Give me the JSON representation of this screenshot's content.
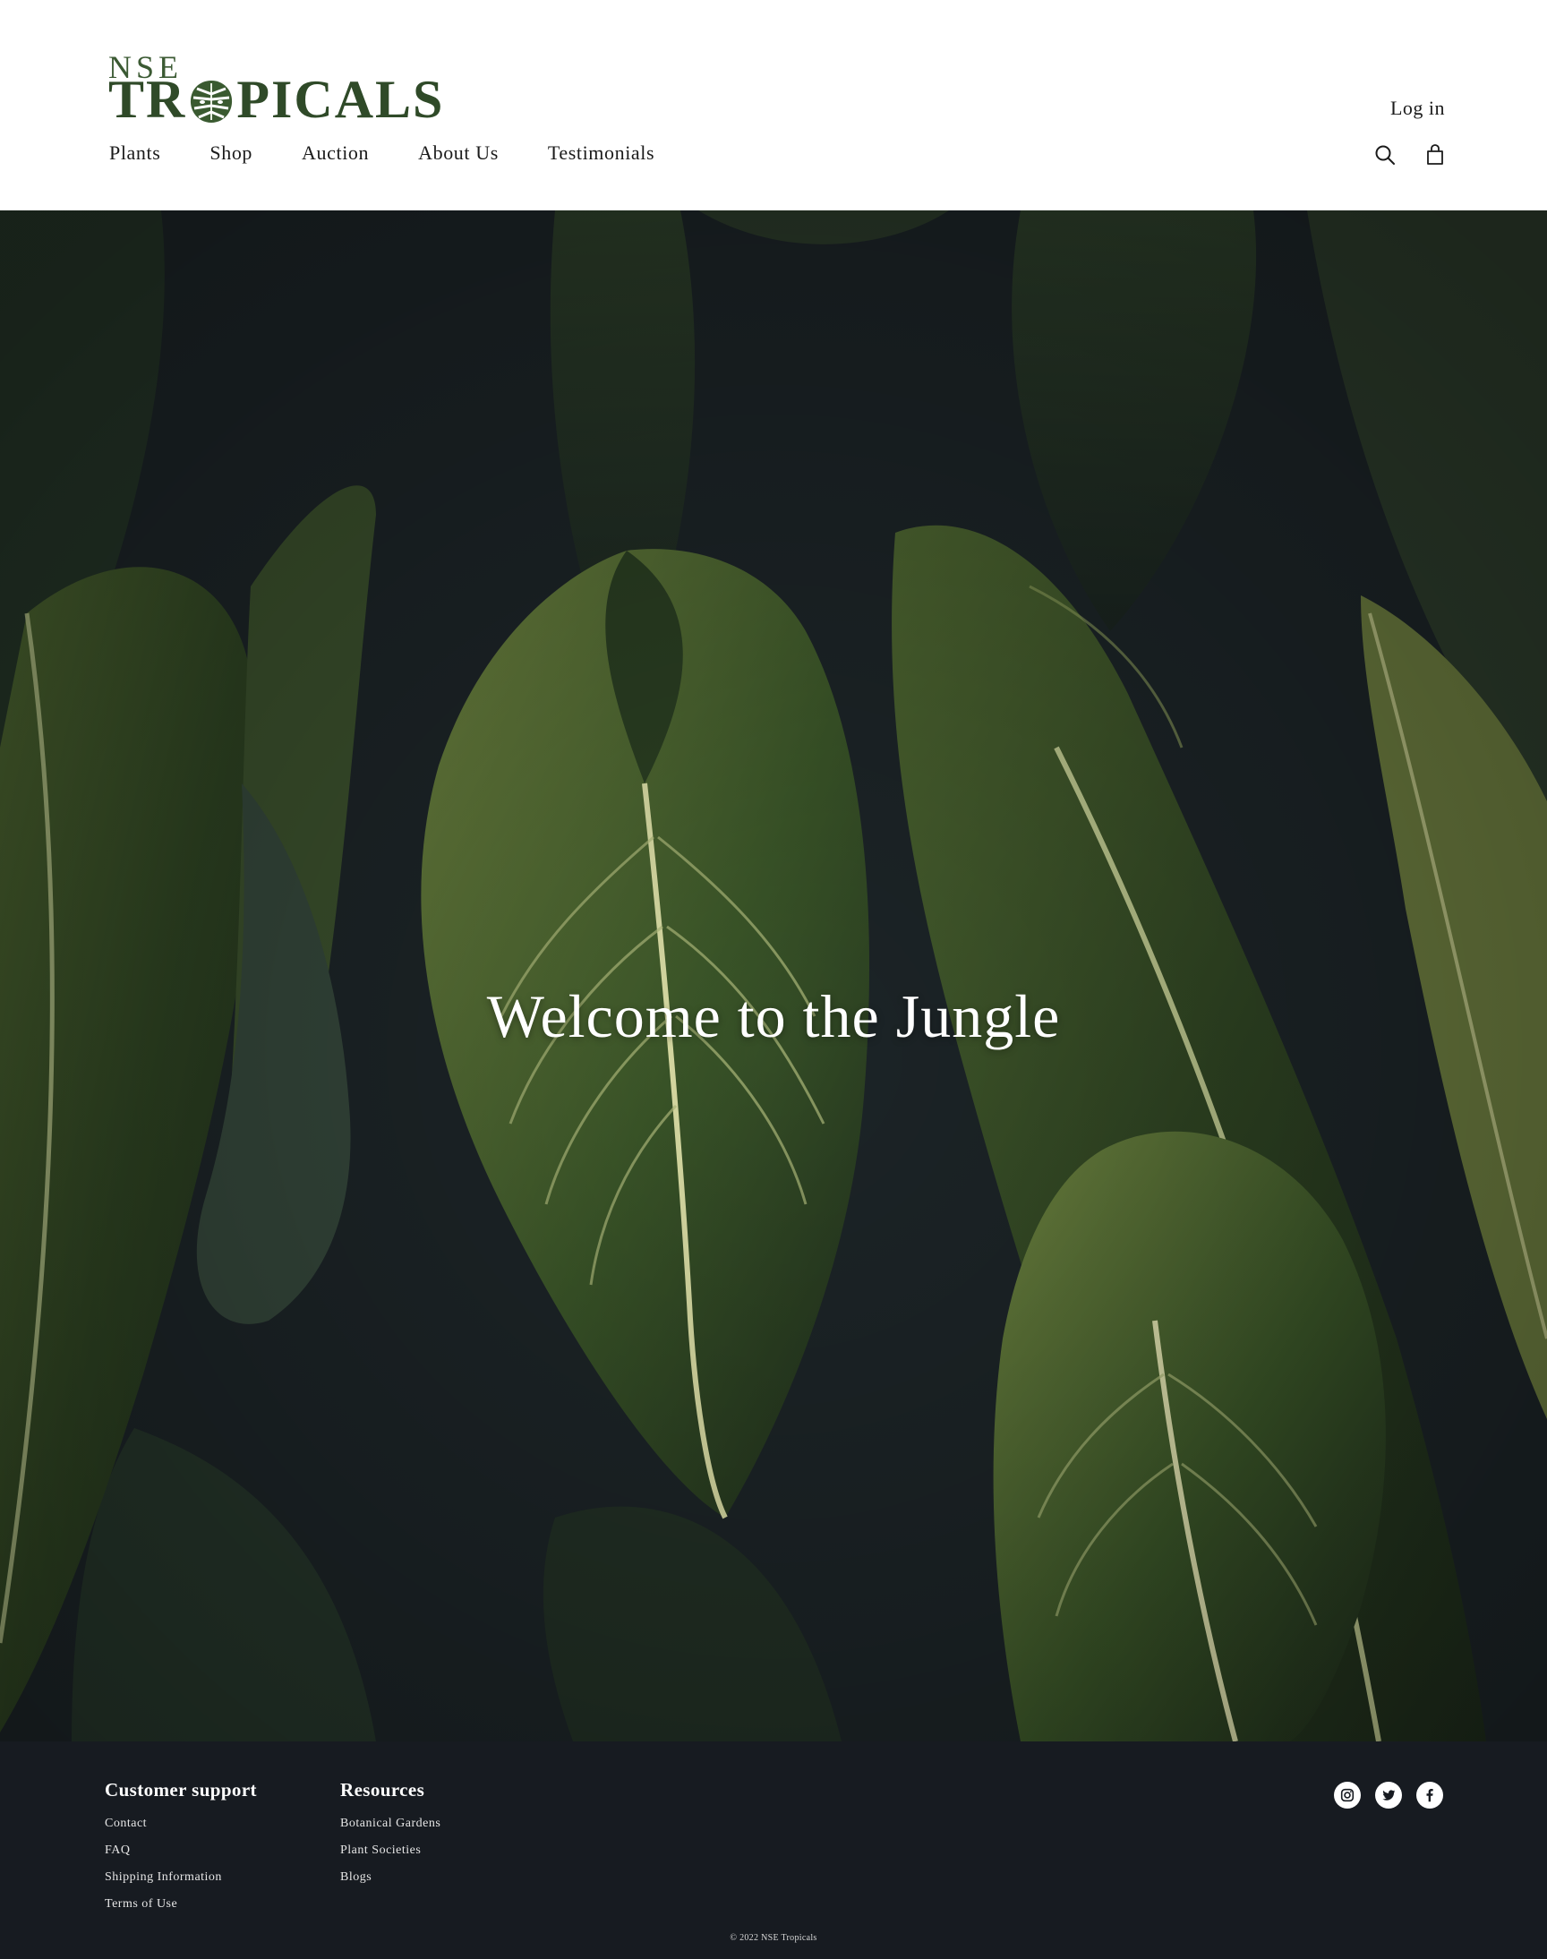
{
  "brand": {
    "prefix": "NSE",
    "main_left": "TR",
    "main_right": "PICALS",
    "color": "#2f4a28"
  },
  "header": {
    "login_label": "Log in",
    "nav": [
      {
        "label": "Plants"
      },
      {
        "label": "Shop"
      },
      {
        "label": "Auction"
      },
      {
        "label": "About Us"
      },
      {
        "label": "Testimonials"
      }
    ],
    "icons": {
      "search": "search-icon",
      "cart": "shopping-bag-icon"
    }
  },
  "hero": {
    "title": "Welcome to the Jungle",
    "image": "tropical-leaves-photo",
    "overlay_color": "#1c2327"
  },
  "footer": {
    "background": "#171b21",
    "columns": [
      {
        "heading": "Customer support",
        "links": [
          "Contact",
          "FAQ",
          "Shipping Information",
          "Terms of Use"
        ]
      },
      {
        "heading": "Resources",
        "links": [
          "Botanical Gardens",
          "Plant Societies",
          "Blogs"
        ]
      }
    ],
    "social": [
      "instagram-icon",
      "twitter-icon",
      "facebook-icon"
    ],
    "copyright": "© 2022 NSE Tropicals"
  }
}
